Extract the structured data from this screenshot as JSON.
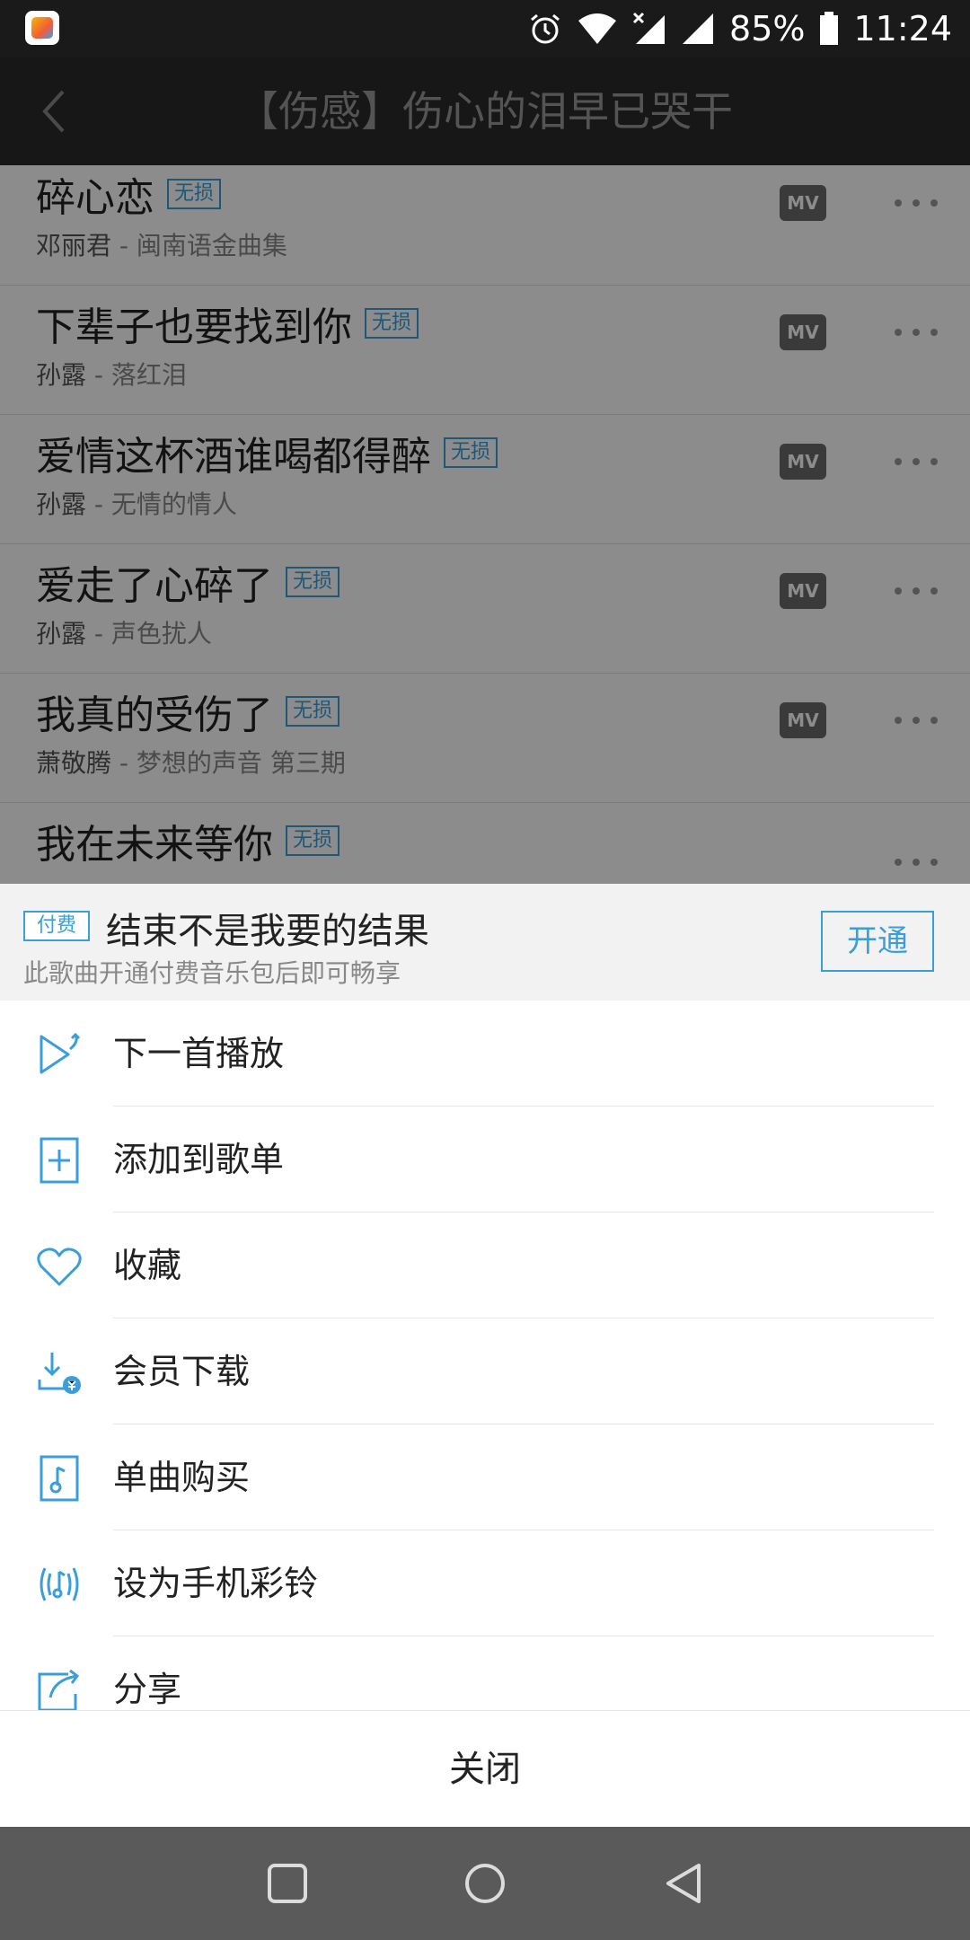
{
  "status_bar": {
    "battery": "85%",
    "time": "11:24",
    "icons": [
      "app-icon",
      "alarm-icon",
      "wifi-icon",
      "signal-off-icon",
      "signal-icon",
      "battery-icon"
    ]
  },
  "header": {
    "title": "【伤感】伤心的泪早已哭干",
    "back_icon": "chevron-left-icon"
  },
  "songs": [
    {
      "title": "碎心恋",
      "badge": "无损",
      "artist": "邓丽君",
      "album": " - 闽南语金曲集",
      "mv": "MV"
    },
    {
      "title": "下辈子也要找到你",
      "badge": "无损",
      "artist": "孙露",
      "album": " - 落红泪",
      "mv": "MV"
    },
    {
      "title": "爱情这杯酒谁喝都得醉",
      "badge": "无损",
      "artist": "孙露",
      "album": " - 无情的情人",
      "mv": "MV"
    },
    {
      "title": "爱走了心碎了",
      "badge": "无损",
      "artist": "孙露",
      "album": " - 声色扰人",
      "mv": "MV"
    },
    {
      "title": "我真的受伤了",
      "badge": "无损",
      "artist": "萧敬腾",
      "album": " - 梦想的声音 第三期",
      "mv": "MV"
    },
    {
      "title": "我在未来等你",
      "badge": "无损",
      "artist": "",
      "album": "",
      "mv": ""
    }
  ],
  "sheet": {
    "paid_badge": "付费",
    "song_title": "结束不是我要的结果",
    "hint": "此歌曲开通付费音乐包后即可畅享",
    "activate_label": "开通",
    "menu": [
      {
        "label": "下一首播放",
        "icon": "play-next-icon"
      },
      {
        "label": "添加到歌单",
        "icon": "add-to-playlist-icon"
      },
      {
        "label": "收藏",
        "icon": "heart-icon"
      },
      {
        "label": "会员下载",
        "icon": "vip-download-icon"
      },
      {
        "label": "单曲购买",
        "icon": "buy-song-icon"
      },
      {
        "label": "设为手机彩铃",
        "icon": "ringtone-icon"
      },
      {
        "label": "分享",
        "icon": "share-icon"
      }
    ],
    "close_label": "关闭"
  },
  "nav_bar": {
    "icons": [
      "recent-apps-icon",
      "home-icon",
      "back-icon"
    ]
  },
  "colors": {
    "accent": "#3a9fd8",
    "header_bg": "#2b2b2b",
    "status_bg": "#1a1a1a",
    "nav_bg": "#5a5a5a",
    "sheet_head_bg": "#f2f2f2"
  }
}
